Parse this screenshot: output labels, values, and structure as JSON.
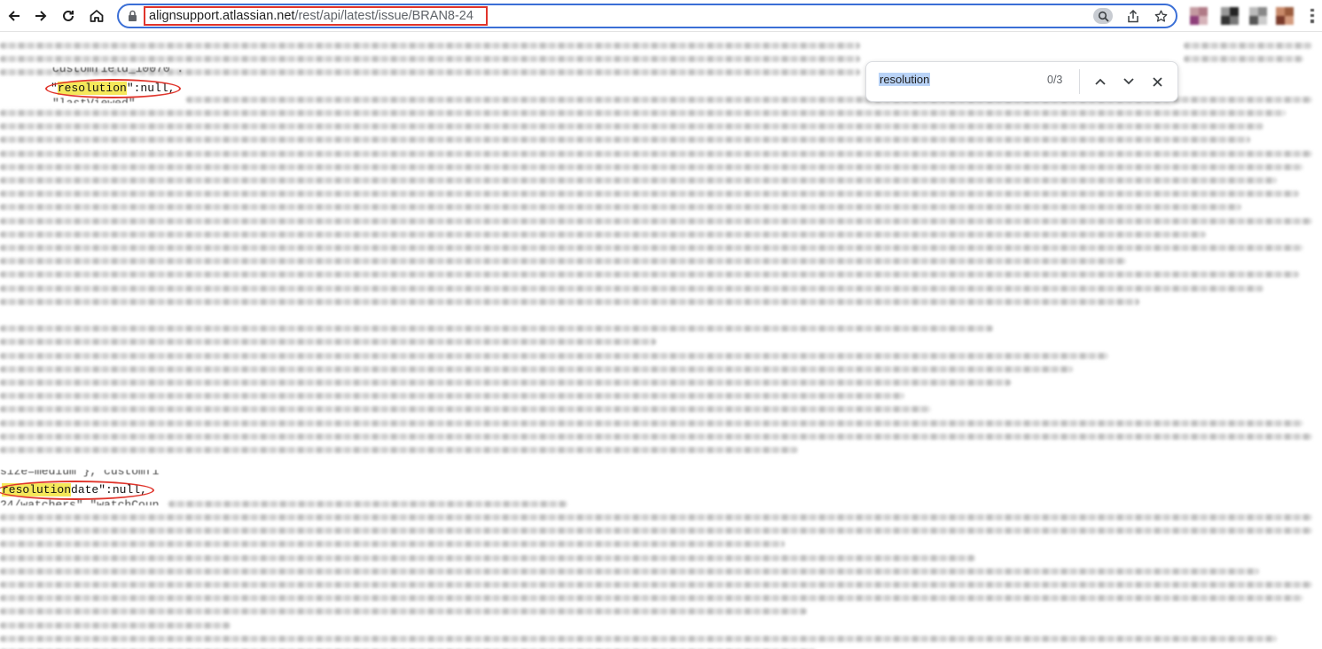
{
  "browser": {
    "url_host": "alignsupport.atlassian.net",
    "url_path": "/rest/api/latest/issue/BRAN8-24",
    "icons": {
      "back": "arrow-left-icon",
      "forward": "arrow-right-icon",
      "reload": "reload-icon",
      "home": "home-icon",
      "lock": "lock-icon",
      "zoom": "zoom-icon",
      "share": "share-icon",
      "bookmark": "star-icon"
    }
  },
  "find_bar": {
    "query": "resolution",
    "count": "0/3"
  },
  "json_view": {
    "match1_partial_above": "customfield_10070\":",
    "match1_open_quote": "\"",
    "match1_key": "resolution",
    "match1_rest": "\":null,",
    "match1_partial_below": "\"lastViewed\"",
    "match2_partial_above": "size=medium\"}, customfi",
    "match2_key": "resolution",
    "match2_rest": "date\":null,",
    "match2_partial_below": "24/watchers\",\"watchCoun"
  },
  "colors": {
    "highlight": "#f5e85a",
    "annotation": "#e0342b",
    "focus_ring": "#3b6fd6"
  }
}
